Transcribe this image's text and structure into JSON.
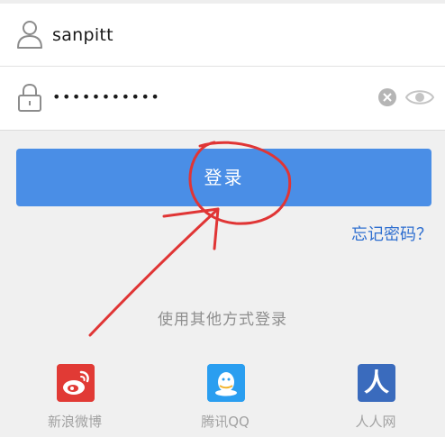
{
  "login_form": {
    "username_value": "sanpitt",
    "password_masked": "•••••••••••",
    "username_icon": "user-icon",
    "password_icon": "lock-icon",
    "clear_icon": "clear-icon",
    "visibility_icon": "eye-icon"
  },
  "actions": {
    "login_label": "登录",
    "forgot_password_label": "忘记密码？"
  },
  "other_login": {
    "heading": "使用其他方式登录",
    "providers": [
      {
        "label": "新浪微博",
        "icon": "weibo-icon",
        "color": "#e13a35"
      },
      {
        "label": "腾讯QQ",
        "icon": "qq-icon",
        "color": "#2a9ef0"
      },
      {
        "label": "人人网",
        "icon": "renren-icon",
        "color": "#3a6bbd",
        "glyph": "人"
      }
    ]
  },
  "colors": {
    "primary_button": "#4a8ee6",
    "link": "#2f6fd0",
    "annotation": "#e03535",
    "background": "#f0f0f0"
  }
}
